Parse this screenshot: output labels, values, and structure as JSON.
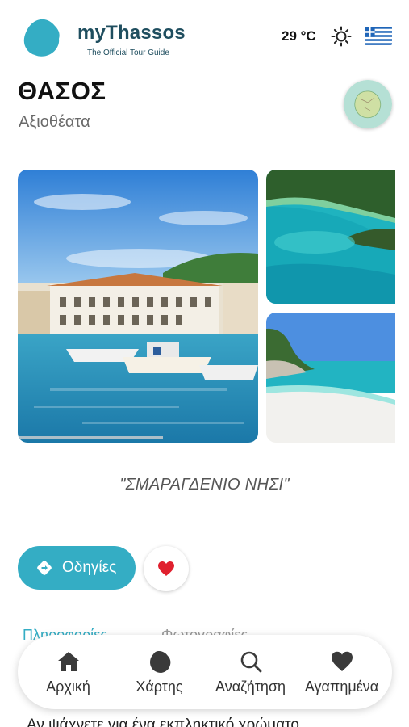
{
  "header": {
    "brand_name": "myThassos",
    "brand_tagline": "The Official Tour Guide",
    "temperature": "29 °C"
  },
  "page": {
    "title": "ΘΑΣΟΣ",
    "subtitle": "Αξιοθέατα",
    "motto": "\"ΣΜΑΡΑΓΔΕΝΙΟ ΝΗΣΙ\""
  },
  "actions": {
    "directions_label": "Οδηγίες"
  },
  "tabs": [
    {
      "label": "Πληροφορίες"
    },
    {
      "label": "Φωτογραφίες"
    }
  ],
  "description_start": "Αν ψάχνετε για ένα εκπληκτικό χρώματο",
  "bottom_nav": [
    {
      "label": "Αρχική",
      "icon": "home-icon"
    },
    {
      "label": "Χάρτης",
      "icon": "map-island-icon"
    },
    {
      "label": "Αναζήτηση",
      "icon": "search-icon"
    },
    {
      "label": "Αγαπημένα",
      "icon": "heart-icon"
    }
  ],
  "colors": {
    "accent": "#34adc4",
    "brand_dark": "#1f4e5f",
    "favorite_red": "#e0202e"
  }
}
